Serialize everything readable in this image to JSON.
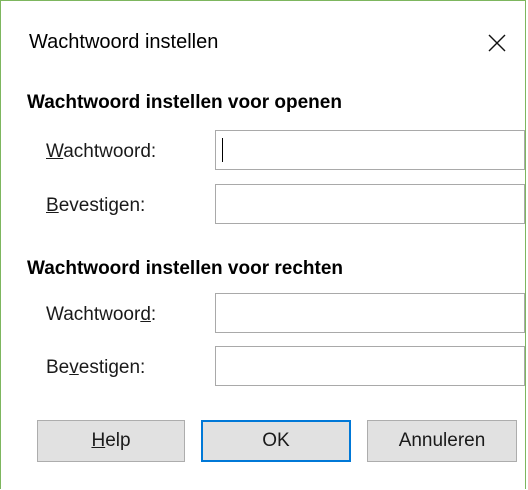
{
  "window": {
    "title": "Wachtwoord instellen",
    "close_icon": "close-icon"
  },
  "open_section": {
    "heading": "Wachtwoord instellen voor openen",
    "password_label_mnemonic": "W",
    "password_label_rest": "achtwoord:",
    "password_value": "",
    "confirm_label_mnemonic": "B",
    "confirm_label_rest": "evestigen:",
    "confirm_value": ""
  },
  "rights_section": {
    "heading": "Wachtwoord instellen voor rechten",
    "password_label_pre": "Wachtwoor",
    "password_label_mnemonic": "d",
    "password_label_post": ":",
    "password_value": "",
    "confirm_label_pre": "Be",
    "confirm_label_mnemonic": "v",
    "confirm_label_post": "estigen:",
    "confirm_value": ""
  },
  "buttons": {
    "help_mnemonic": "H",
    "help_rest": "elp",
    "ok_label": "OK",
    "cancel_label": "Annuleren"
  },
  "colors": {
    "window_border": "#7db65e",
    "default_button_border": "#0078d7",
    "button_face": "#e1e1e1"
  }
}
